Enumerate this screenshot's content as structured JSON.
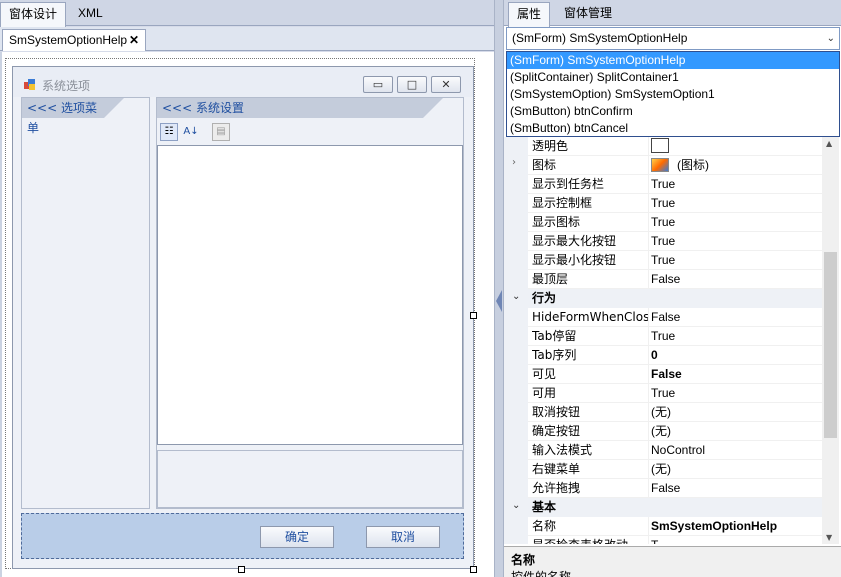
{
  "left_tabs": {
    "design": "窗体设计",
    "xml": "XML"
  },
  "doc_tab": {
    "label": "SmSystemOptionHelp",
    "close": "✕"
  },
  "form": {
    "title": "系统选项",
    "min_glyph": "▭",
    "max_glyph": "□",
    "close_glyph": "✕",
    "left_panel_header": "<<< 选项菜单",
    "right_panel_header": "<<< 系统设置",
    "confirm": "确定",
    "cancel": "取消"
  },
  "right_tabs": {
    "properties": "属性",
    "form_manage": "窗体管理"
  },
  "object_combo": {
    "value": "(SmForm) SmSystemOptionHelp"
  },
  "dropdown_items": [
    "(SmForm) SmSystemOptionHelp",
    "(SplitContainer) SplitContainer1",
    "(SmSystemOption) SmSystemOption1",
    "(SmButton) btnConfirm",
    "(SmButton) btnCancel"
  ],
  "properties": {
    "rows_a": [
      {
        "name": "透明色",
        "value": "",
        "kind": "swatch"
      },
      {
        "name": "图标",
        "value": "(图标)",
        "kind": "icon"
      },
      {
        "name": "显示到任务栏",
        "value": "True"
      },
      {
        "name": "显示控制框",
        "value": "True"
      },
      {
        "name": "显示图标",
        "value": "True"
      },
      {
        "name": "显示最大化按钮",
        "value": "True"
      },
      {
        "name": "显示最小化按钮",
        "value": "True"
      },
      {
        "name": "最顶层",
        "value": "False"
      }
    ],
    "cat_behavior": "行为",
    "rows_b": [
      {
        "name": "HideFormWhenClos",
        "value": "False"
      },
      {
        "name": "Tab停留",
        "value": "True"
      },
      {
        "name": "Tab序列",
        "value": "0",
        "bold": true
      },
      {
        "name": "可见",
        "value": "False",
        "bold": true
      },
      {
        "name": "可用",
        "value": "True"
      },
      {
        "name": "取消按钮",
        "value": "(无)"
      },
      {
        "name": "确定按钮",
        "value": "(无)"
      },
      {
        "name": "输入法模式",
        "value": "NoControl"
      },
      {
        "name": "右键菜单",
        "value": "(无)"
      },
      {
        "name": "允许拖拽",
        "value": "False"
      }
    ],
    "cat_basic": "基本",
    "rows_c": [
      {
        "name": "名称",
        "value": "SmSystemOptionHelp",
        "bold": true
      },
      {
        "name": "是否检查表格改动",
        "value": "T"
      }
    ]
  },
  "help": {
    "title": "名称",
    "desc": "控件的名称"
  }
}
